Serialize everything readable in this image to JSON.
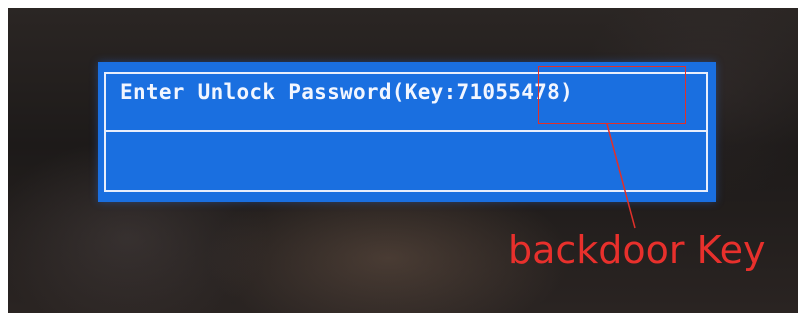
{
  "bios": {
    "prompt": "Enter Unlock Password(Key:71055478)",
    "input_value": ""
  },
  "annotation": {
    "text": "backdoor Key",
    "color": "#e8302c"
  },
  "colors": {
    "dialog_background": "#1a6fe0",
    "dialog_border": "#e8eefc",
    "prompt_text": "#f2f6ff"
  }
}
